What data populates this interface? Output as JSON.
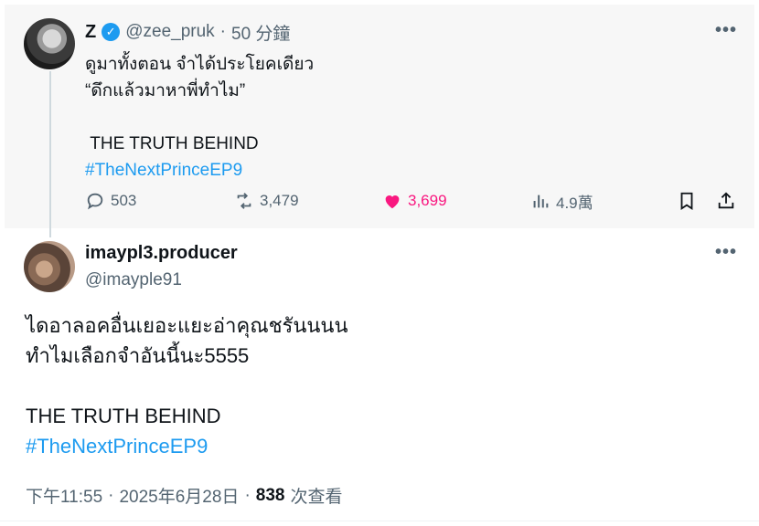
{
  "parent_tweet": {
    "display_name": "Z",
    "handle": "@zee_pruk",
    "separator": "·",
    "time_ago": "50 分鐘",
    "text_line1": "ดูมาทั้งตอน จำได้ประโยคเดียว",
    "text_line2": "“ดึกแล้วมาหาพี่ทำไม”",
    "text_line3": " THE TRUTH BEHIND",
    "hashtag": "#TheNextPrinceEP9",
    "stats": {
      "replies": "503",
      "retweets": "3,479",
      "likes": "3,699",
      "views": "4.9萬"
    }
  },
  "main_tweet": {
    "display_name": "imaypl3.producer",
    "handle": "@imayple91",
    "text_line1": "ไดอาลอคอื่นเยอะแยะอ่าคุณชรันนนน",
    "text_line2": "ทำไมเลือกจำอันนี้นะ5555",
    "text_line3": "THE TRUTH BEHIND",
    "hashtag": "#TheNextPrinceEP9",
    "time": "下午11:55",
    "date": "2025年6月28日",
    "views_count": "838",
    "views_label": "次查看",
    "separator": "·"
  },
  "colors": {
    "accent": "#1d9bf0",
    "like": "#f91880",
    "muted": "#536471"
  },
  "icons": [
    "verified-badge-icon",
    "more-icon",
    "reply-icon",
    "retweet-icon",
    "heart-icon",
    "views-icon",
    "bookmark-icon",
    "share-icon"
  ]
}
